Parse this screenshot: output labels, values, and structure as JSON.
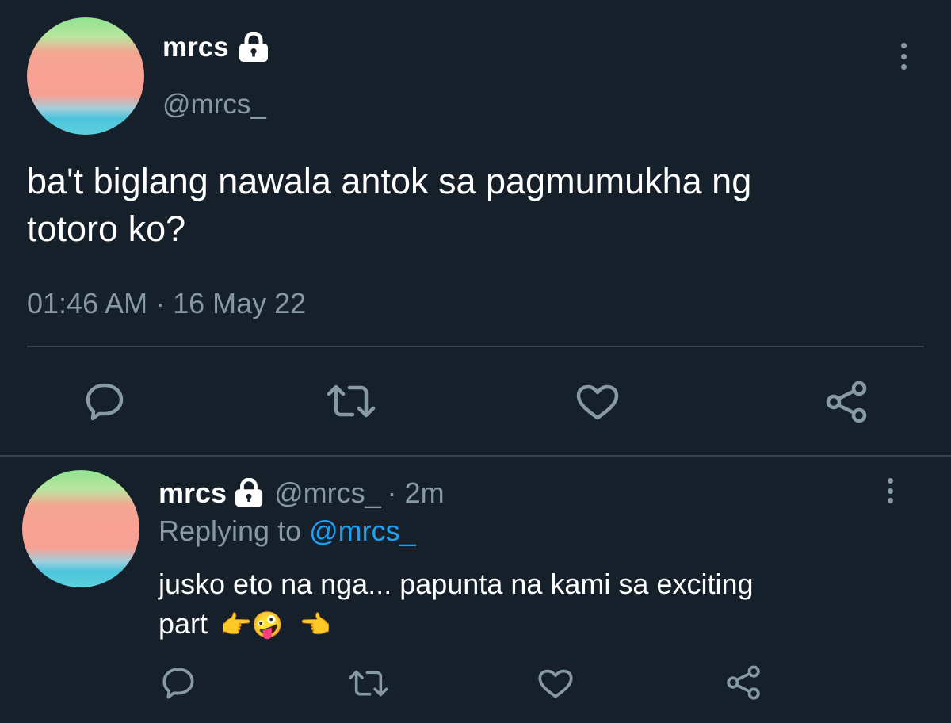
{
  "tweet": {
    "display_name": "mrcs",
    "handle": "@mrcs_",
    "text_line1": "ba't biglang nawala antok sa pagmumukha ng",
    "text_line2": "totoro ko?",
    "timestamp": "01:46 AM · 16 May 22",
    "icons": {
      "reply": "reply-icon",
      "retweet": "retweet-icon",
      "like": "heart-icon",
      "share": "share-icon",
      "more": "more-vertical-icon",
      "lock": "lock-icon"
    }
  },
  "reply": {
    "display_name": "mrcs",
    "handle": "@mrcs_",
    "age": "· 2m",
    "replying_prefix": "Replying to",
    "replying_handle": "@mrcs_",
    "text_line1": "jusko eto na nga... papunta na kami sa exciting",
    "text_line2": "part",
    "emojis": [
      "👉",
      "🤪",
      "👈"
    ]
  },
  "colors": {
    "background": "#15202b",
    "text": "#ffffff",
    "muted": "#8899a6",
    "link": "#1da1f2",
    "divider": "#38444d"
  }
}
